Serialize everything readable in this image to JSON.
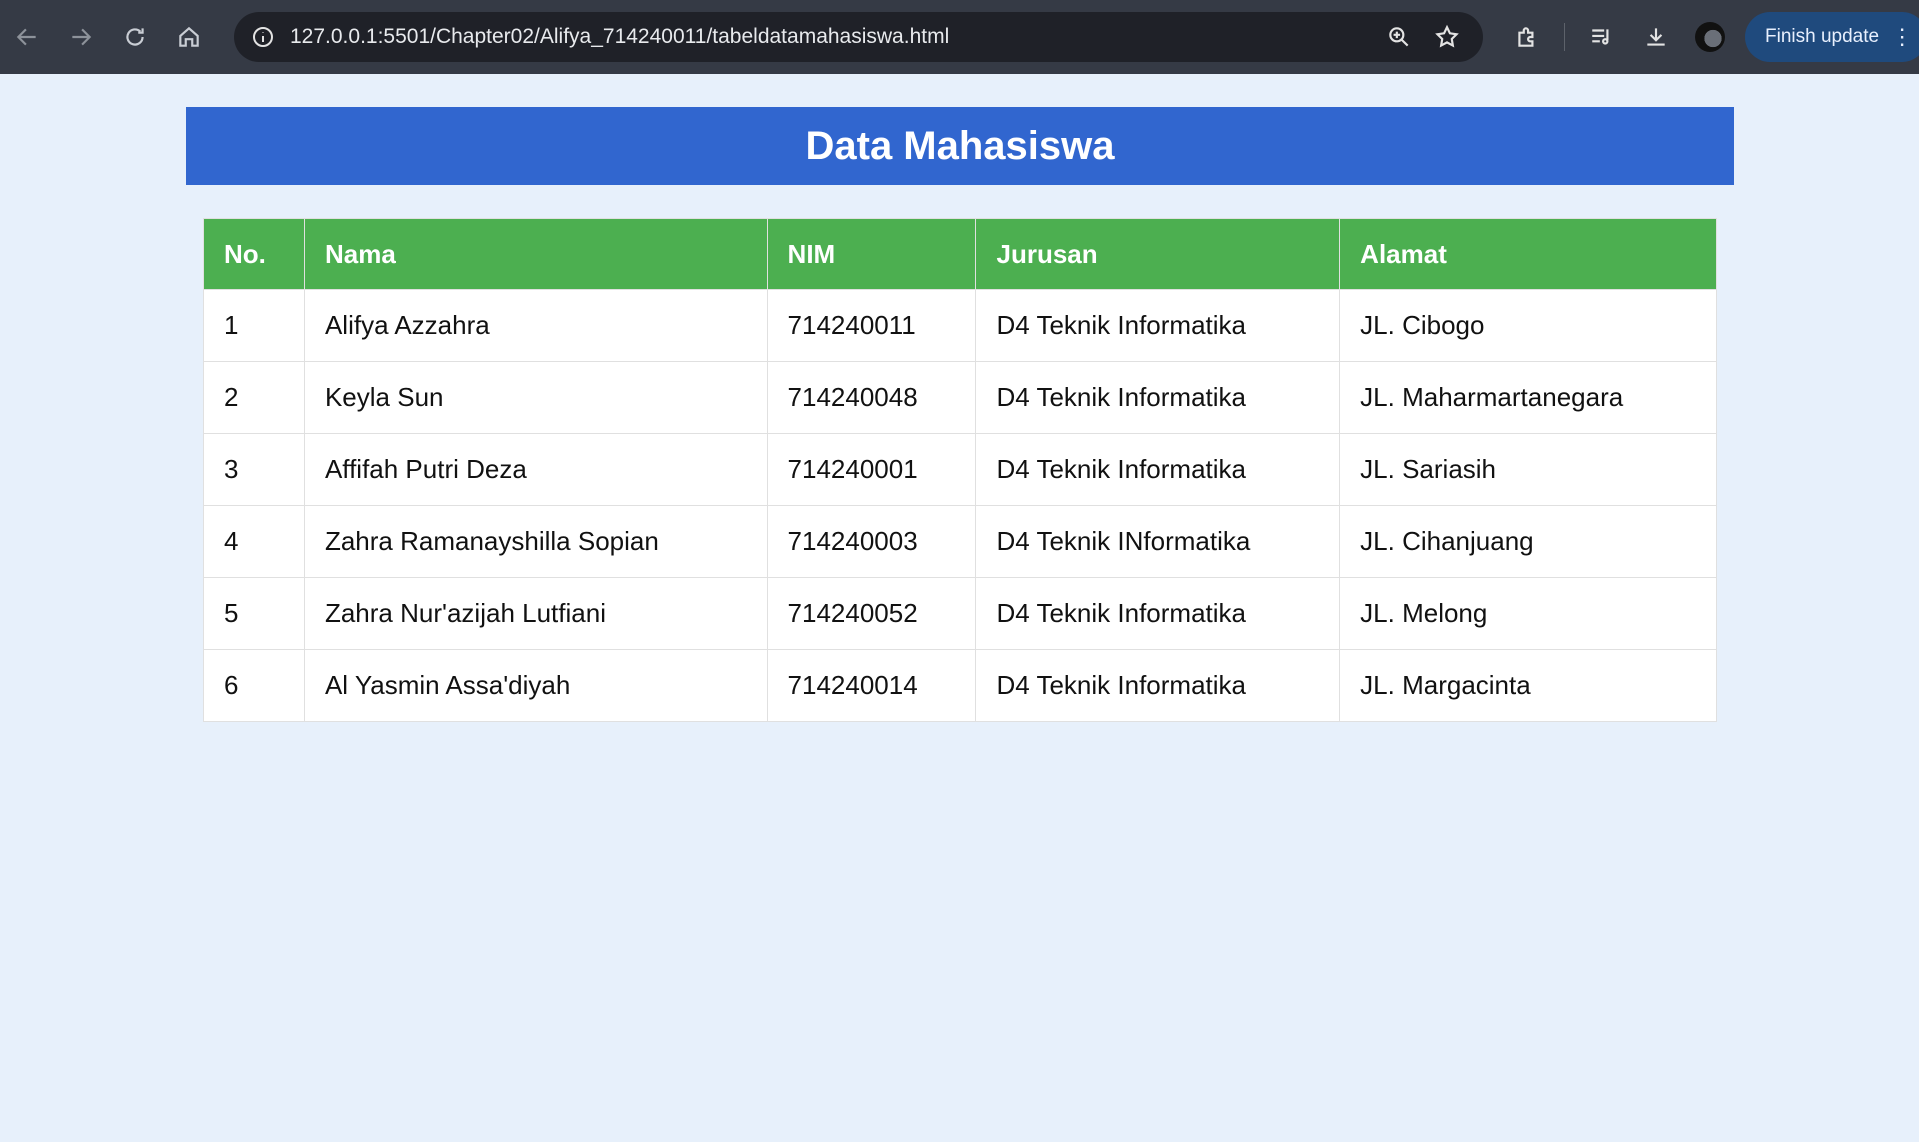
{
  "browser": {
    "url": "127.0.0.1:5501/Chapter02/Alifya_714240011/tabeldatamahasiswa.html",
    "update_label": "Finish update",
    "icons": {
      "back": "back-arrow-icon",
      "forward": "forward-arrow-icon",
      "reload": "reload-icon",
      "home": "home-icon",
      "site_info": "info-icon",
      "zoom": "zoom-icon",
      "bookmark": "star-icon",
      "extensions": "puzzle-icon",
      "media": "media-queue-icon",
      "downloads": "download-icon",
      "menu": "more-vertical-icon"
    }
  },
  "page": {
    "title": "Data Mahasiswa",
    "colors": {
      "banner": "#3166cf",
      "header": "#4caf50",
      "background": "#e7f0fb"
    },
    "table": {
      "headers": [
        "No.",
        "Nama",
        "NIM",
        "Jurusan",
        "Alamat"
      ],
      "rows": [
        [
          "1",
          "Alifya Azzahra",
          "714240011",
          "D4 Teknik Informatika",
          "JL. Cibogo"
        ],
        [
          "2",
          "Keyla Sun",
          "714240048",
          "D4 Teknik Informatika",
          "JL. Maharmartanegara"
        ],
        [
          "3",
          "Affifah Putri Deza",
          "714240001",
          "D4 Teknik Informatika",
          "JL. Sariasih"
        ],
        [
          "4",
          "Zahra Ramanayshilla Sopian",
          "714240003",
          "D4 Teknik INformatika",
          "JL. Cihanjuang"
        ],
        [
          "5",
          "Zahra Nur'azijah Lutfiani",
          "714240052",
          "D4 Teknik Informatika",
          "JL. Melong"
        ],
        [
          "6",
          "Al Yasmin Assa'diyah",
          "714240014",
          "D4 Teknik Informatika",
          "JL. Margacinta"
        ]
      ]
    }
  }
}
